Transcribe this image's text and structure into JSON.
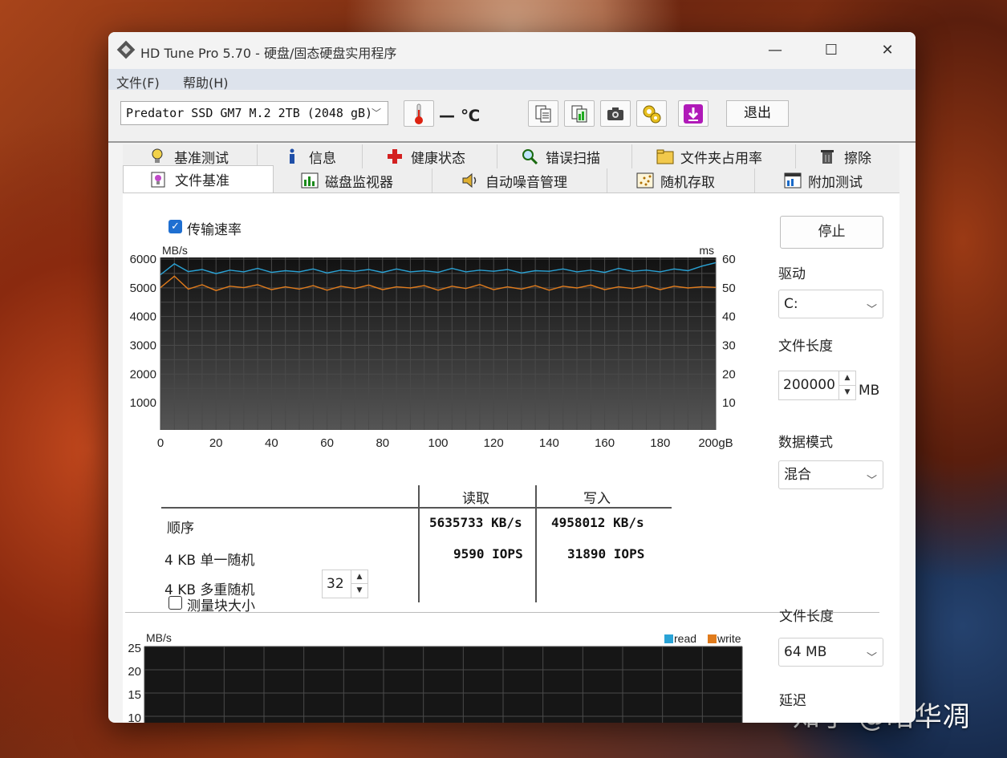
{
  "window": {
    "title": "HD Tune Pro 5.70 - 硬盘/固态硬盘实用程序",
    "minimize": "—",
    "maximize": "☐",
    "close": "✕"
  },
  "menu": [
    "文件(F)",
    "帮助(H)"
  ],
  "toolbar": {
    "drive": "Predator SSD GM7 M.2 2TB (2048 gB)",
    "temperature": "— ℃",
    "exit_label": "退出",
    "icons": [
      "copy-text-icon",
      "copy-image-icon",
      "camera-icon",
      "options-icon",
      "download-icon"
    ]
  },
  "tabs_row1": [
    "基准测试",
    "信息",
    "健康状态",
    "错误扫描",
    "文件夹占用率",
    "擦除"
  ],
  "tabs_row2": [
    "文件基准",
    "磁盘监视器",
    "自动噪音管理",
    "随机存取",
    "附加测试"
  ],
  "active_tab": "文件基准",
  "transfer": {
    "checkbox_label": "传输速率",
    "checked": true,
    "left_unit": "MB/s",
    "right_unit": "ms",
    "x_unit": "gB"
  },
  "chart_data": [
    {
      "type": "line",
      "x_ticks": [
        "0",
        "20",
        "40",
        "60",
        "80",
        "100",
        "120",
        "140",
        "160",
        "180",
        "200gB"
      ],
      "y_left_ticks": [
        "6000",
        "5000",
        "4000",
        "3000",
        "2000",
        "1000"
      ],
      "y_right_ticks": [
        "60",
        "50",
        "40",
        "30",
        "20",
        "10"
      ],
      "ylim": [
        0,
        6000
      ],
      "xlim": [
        0,
        200
      ],
      "grid": true,
      "series": [
        {
          "color": "#2aa3d6",
          "values": [
            5400,
            5780,
            5510,
            5580,
            5440,
            5560,
            5500,
            5620,
            5480,
            5540,
            5500,
            5600,
            5460,
            5560,
            5520,
            5580,
            5480,
            5600,
            5500,
            5540,
            5480,
            5620,
            5500,
            5560,
            5520,
            5580,
            5460,
            5540,
            5520,
            5600,
            5500,
            5560,
            5480,
            5620,
            5520,
            5560,
            5500,
            5600,
            5540,
            5700,
            5820
          ]
        },
        {
          "color": "#e07b1c",
          "values": [
            4950,
            5350,
            4900,
            5050,
            4850,
            5000,
            4950,
            5050,
            4880,
            4980,
            4900,
            5020,
            4860,
            5000,
            4920,
            5040,
            4880,
            4980,
            4940,
            5020,
            4860,
            5000,
            4920,
            5060,
            4880,
            4980,
            4900,
            5020,
            4860,
            5000,
            4940,
            5040,
            4880,
            4980,
            4920,
            5020,
            4880,
            5000,
            4940,
            4980,
            4960
          ]
        }
      ]
    },
    {
      "type": "bar",
      "ylabel": "MB/s",
      "y_ticks": [
        "25",
        "20",
        "15",
        "10"
      ],
      "legend": [
        "read",
        "write"
      ],
      "legend_colors": [
        "#2aa3d6",
        "#e07b1c"
      ],
      "grid": true,
      "series": []
    }
  ],
  "results": {
    "col_read": "读取",
    "col_write": "写入",
    "rows": [
      {
        "label": "顺序",
        "read": "5635733 KB/s",
        "write": "4958012 KB/s"
      },
      {
        "label": "4 KB 单一随机",
        "read": "9590 IOPS",
        "write": "31890 IOPS"
      },
      {
        "label": "4 KB 多重随机",
        "read": "",
        "write": ""
      }
    ],
    "queue_depth": "32"
  },
  "side": {
    "stop_label": "停止",
    "drive_label": "驱动",
    "drive_value": "C:",
    "file_len_label": "文件长度",
    "file_len_value": "200000",
    "file_len_unit": "MB",
    "data_mode_label": "数据模式",
    "data_mode_value": "混合"
  },
  "block": {
    "checkbox_label": "测量块大小",
    "checked": false,
    "file_len_label": "文件长度",
    "file_len_value": "64 MB",
    "delay_label": "延迟"
  },
  "watermark": "知乎 @昭华凋"
}
